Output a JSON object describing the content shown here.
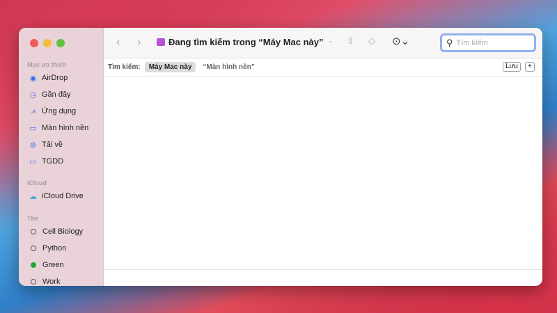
{
  "sidebar": {
    "favorites_header": "Mục ưa thích",
    "favorites": [
      {
        "label": "AirDrop",
        "icon": "airdrop-icon"
      },
      {
        "label": "Gần đây",
        "icon": "clock-icon"
      },
      {
        "label": "Ứng dụng",
        "icon": "apps-icon"
      },
      {
        "label": "Màn hình nền",
        "icon": "desktop-icon"
      },
      {
        "label": "Tải về",
        "icon": "download-icon"
      },
      {
        "label": "TGDD",
        "icon": "folder-icon"
      }
    ],
    "icloud_header": "iCloud",
    "icloud": [
      {
        "label": "iCloud Drive",
        "icon": "cloud-icon"
      }
    ],
    "tags_header": "Thẻ",
    "tags": [
      {
        "label": "Cell Biology",
        "color": ""
      },
      {
        "label": "Python",
        "color": ""
      },
      {
        "label": "Green",
        "color": "#1fa83a"
      },
      {
        "label": "Work",
        "color": ""
      }
    ]
  },
  "toolbar": {
    "title": "Đang tìm kiếm trong “Máy Mac này”",
    "search_placeholder": "Tìm kiếm"
  },
  "scope_bar": {
    "label": "Tìm kiếm:",
    "scopes": [
      "Máy Mac này",
      "“Màn hình nền”"
    ],
    "save": "Lưu",
    "add": "+"
  }
}
